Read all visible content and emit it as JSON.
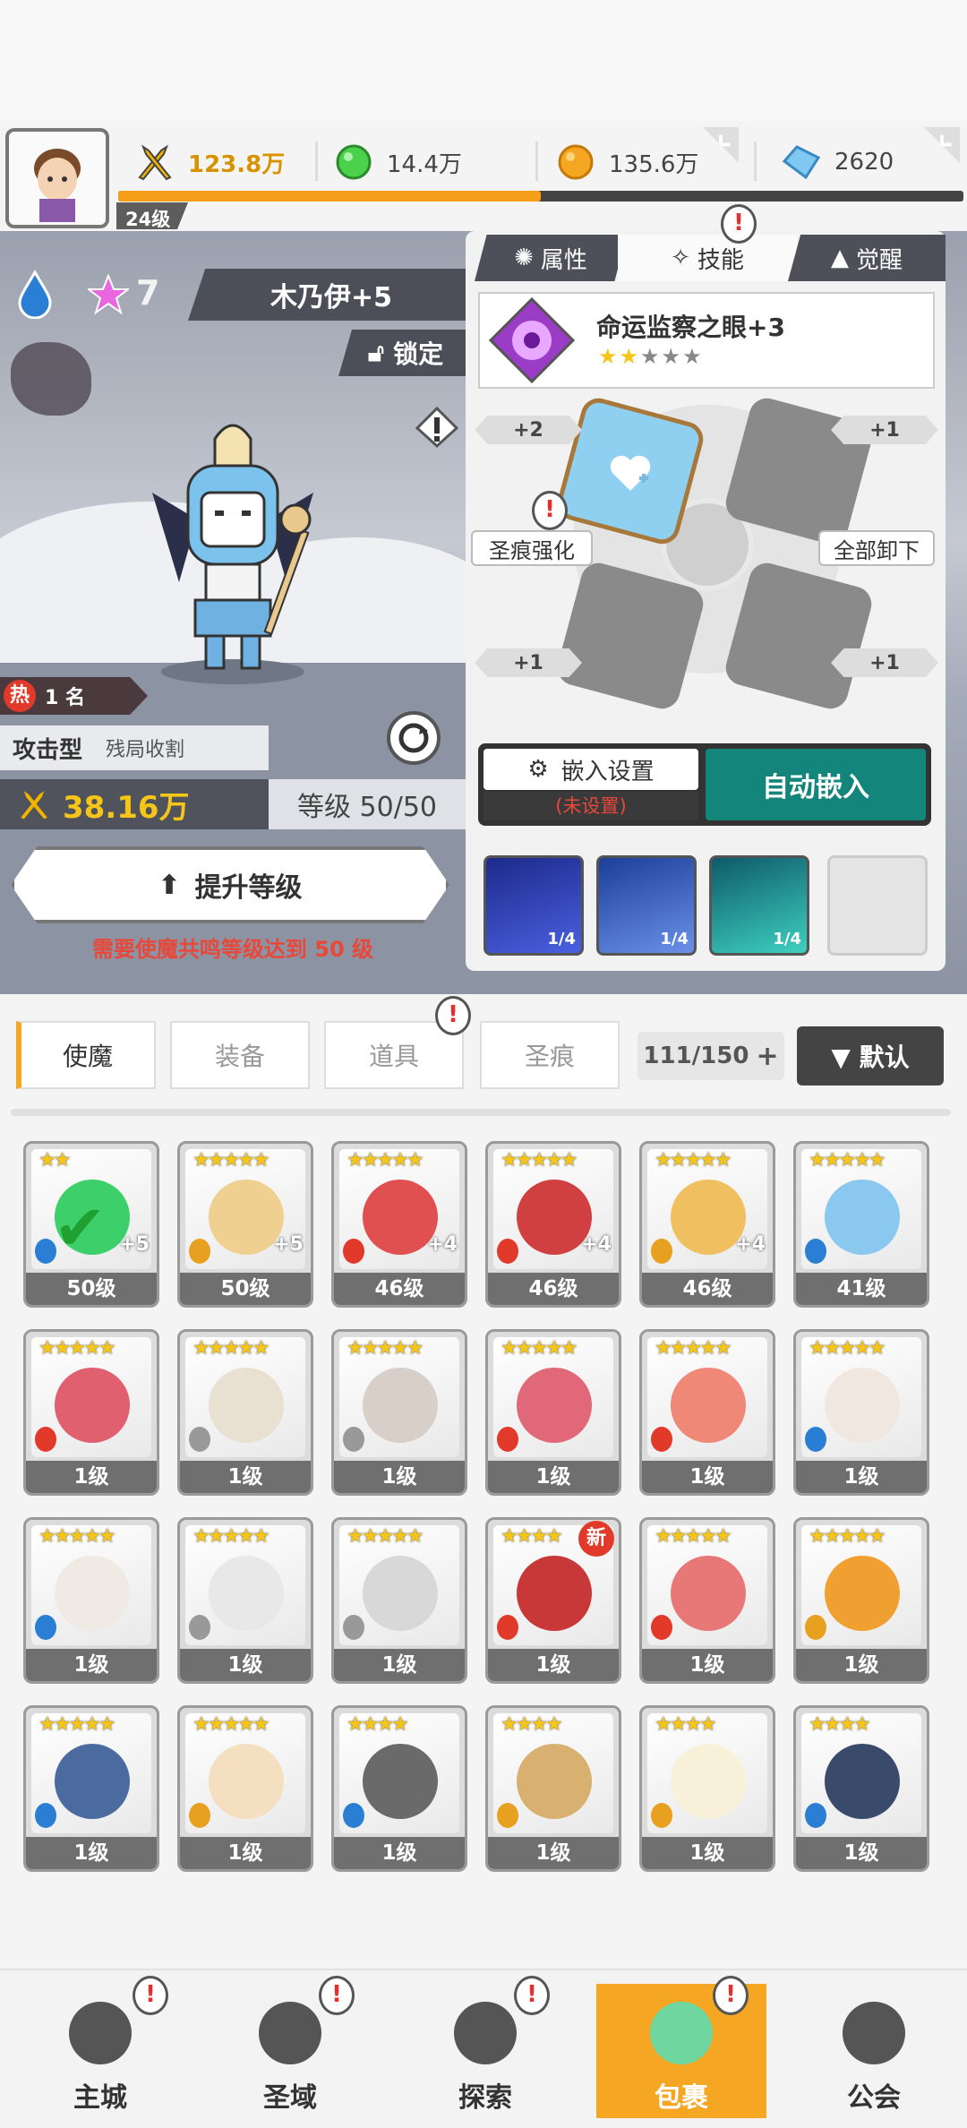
{
  "header": {
    "level": "24级",
    "power_resource": "123.8万",
    "green_gems": "14.4万",
    "gold": "135.6万",
    "diamonds": "2620",
    "xp_fraction": 0.5
  },
  "hero": {
    "name": "木乃伊+5",
    "stars": "7",
    "lock_label": "锁定",
    "rank": "1 名",
    "hot_label": "热",
    "type": "攻击型",
    "trait": "残局收割",
    "power": "38.16万",
    "level_text": "等级 50/50",
    "upgrade_label": "提升等级",
    "warning": "需要使魔共鸣等级达到 50 级"
  },
  "panel": {
    "tabs": [
      "属性",
      "技能",
      "觉醒"
    ],
    "active_tab": "技能",
    "skill_name": "命运监察之眼+3",
    "skill_stars_filled": 2,
    "skill_stars_total": 5,
    "socket_bonus": [
      "+2",
      "+1",
      "+1",
      "+1"
    ],
    "strengthen_label": "圣痕强化",
    "unload_label": "全部卸下",
    "embed_settings_label": "嵌入设置",
    "embed_status": "(未设置)",
    "auto_embed_label": "自动嵌入",
    "runes": [
      "1/4",
      "1/4",
      "1/4"
    ]
  },
  "inventory": {
    "tabs": [
      "使魔",
      "装备",
      "道具",
      "圣痕"
    ],
    "active_tab": "使魔",
    "count": "111/150",
    "sort_label": "▼ 默认",
    "new_badge": "新",
    "cards": [
      {
        "level": "50级",
        "plus": "+5",
        "stars": "★★"
      },
      {
        "level": "50级",
        "plus": "+5",
        "stars": "★★★★★"
      },
      {
        "level": "46级",
        "plus": "+4",
        "stars": "★★★★★"
      },
      {
        "level": "46级",
        "plus": "+4",
        "stars": "★★★★★"
      },
      {
        "level": "46级",
        "plus": "+4",
        "stars": "★★★★★"
      },
      {
        "level": "41级",
        "plus": "",
        "stars": "★★★★★"
      },
      {
        "level": "1级",
        "plus": "",
        "stars": "★★★★★"
      },
      {
        "level": "1级",
        "plus": "",
        "stars": "★★★★★"
      },
      {
        "level": "1级",
        "plus": "",
        "stars": "★★★★★"
      },
      {
        "level": "1级",
        "plus": "",
        "stars": "★★★★★"
      },
      {
        "level": "1级",
        "plus": "",
        "stars": "★★★★★"
      },
      {
        "level": "1级",
        "plus": "",
        "stars": "★★★★★"
      },
      {
        "level": "1级",
        "plus": "",
        "stars": "★★★★★"
      },
      {
        "level": "1级",
        "plus": "",
        "stars": "★★★★★"
      },
      {
        "level": "1级",
        "plus": "",
        "stars": "★★★★★"
      },
      {
        "level": "1级",
        "plus": "",
        "stars": "★★★★"
      },
      {
        "level": "1级",
        "plus": "",
        "stars": "★★★★★"
      },
      {
        "level": "1级",
        "plus": "",
        "stars": "★★★★★"
      },
      {
        "level": "1级",
        "plus": "",
        "stars": "★★★★★"
      },
      {
        "level": "1级",
        "plus": "",
        "stars": "★★★★★"
      },
      {
        "level": "1级",
        "plus": "",
        "stars": "★★★★"
      },
      {
        "level": "1级",
        "plus": "",
        "stars": "★★★★"
      },
      {
        "level": "1级",
        "plus": "",
        "stars": "★★★★"
      },
      {
        "level": "1级",
        "plus": "",
        "stars": "★★★★"
      }
    ]
  },
  "nav": [
    "主城",
    "圣域",
    "探索",
    "包裹",
    "公会"
  ],
  "nav_active": "包裹",
  "colors": {
    "accent_orange": "#f59e1a",
    "auto_embed_teal": "#13857a",
    "warning_red": "#e8483a"
  }
}
